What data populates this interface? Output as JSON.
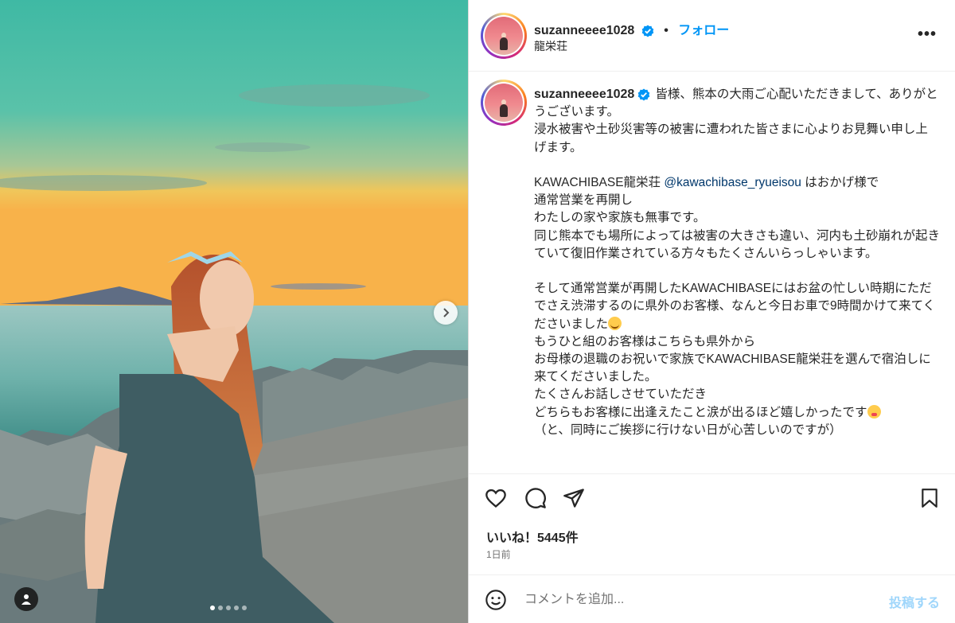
{
  "post": {
    "username": "suzanneeee1028",
    "follow_label": "フォロー",
    "separator": "•",
    "location": "龍栄荘",
    "more_label": "•••",
    "caption": {
      "line1": "皆様、熊本の大雨ご心配いただきまして、ありがとうございます。",
      "line2": "浸水被害や土砂災害等の被害に遭われた皆さまに心よりお見舞い申し上げます。",
      "line3a": "KAWACHIBASE龍栄荘 ",
      "mention": "@kawachibase_ryueisou",
      "line3b": " はおかげ様で",
      "line4": "通常営業を再開し",
      "line5": "わたしの家や家族も無事です。",
      "line6": "同じ熊本でも場所によっては被害の大きさも違い、河内も土砂崩れが起きていて復旧作業されている方々もたくさんいらっしゃいます。",
      "line7": "そして通常営業が再開したKAWACHIBASEにはお盆の忙しい時期にただでさえ渋滞するのに県外のお客様、なんと今日お車で9時間かけて来てくださいました",
      "line8": "もうひと組のお客様はこちらも県外から",
      "line9": "お母様の退職のお祝いで家族でKAWACHIBASE龍栄荘を選んで宿泊しに来てくださいました。",
      "line10": "たくさんお話しさせていただき",
      "line11": "どちらもお客様に出逢えたこと涙が出るほど嬉しかったです",
      "line12": "（と、同時にご挨拶に行けない日が心苦しいのですが）"
    },
    "likes_label": "いいね！5445件",
    "time_label": "1日前",
    "comment": {
      "placeholder": "コメントを追加...",
      "post_label": "投稿する"
    },
    "carousel": {
      "count": 5,
      "active": 0
    },
    "icons": [
      "heart-icon",
      "comment-icon",
      "share-icon",
      "bookmark-icon",
      "emoji-icon",
      "next-arrow-icon",
      "user-tag-icon",
      "verified-badge-icon",
      "more-options-icon"
    ],
    "colors": {
      "accent": "#0095f6",
      "text": "#262626",
      "muted": "#737373",
      "post_disabled": "#9fd6fb"
    }
  }
}
